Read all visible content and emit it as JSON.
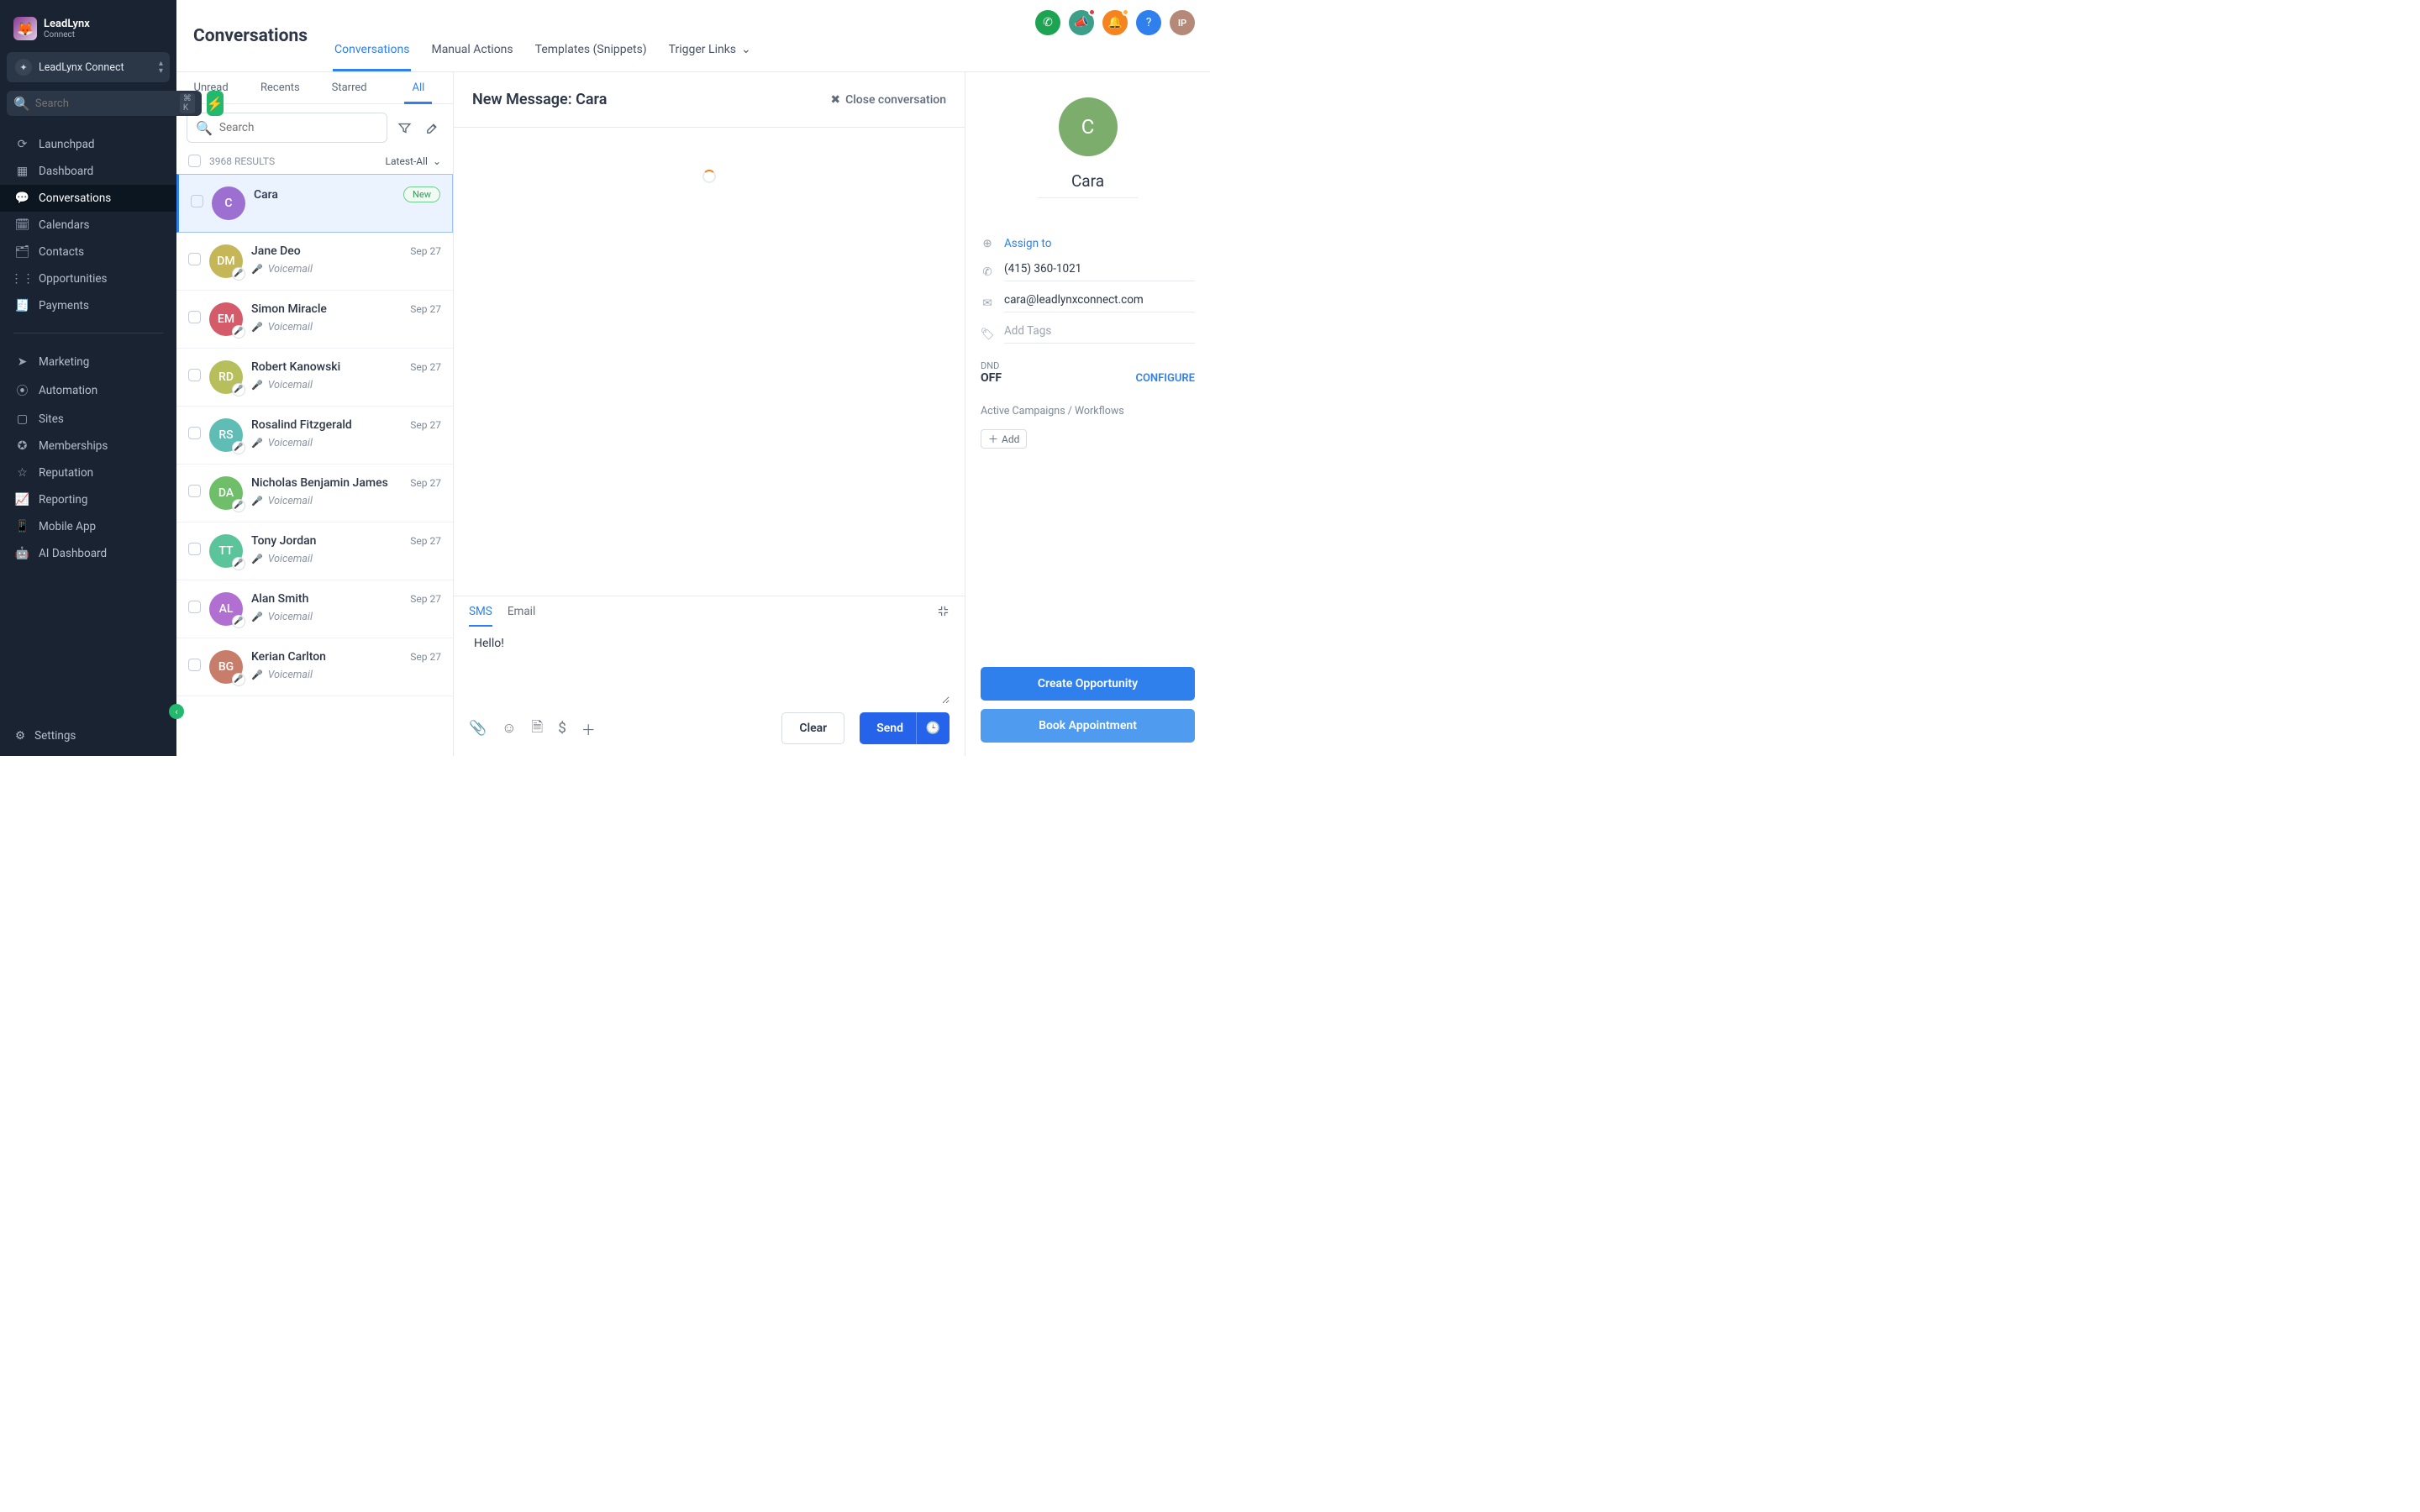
{
  "brand": {
    "name": "LeadLynx",
    "sub": "Connect"
  },
  "org": {
    "name": "LeadLynx Connect"
  },
  "globalSearch": {
    "placeholder": "Search",
    "kbd": "⌘ K"
  },
  "nav": {
    "items": [
      {
        "label": "Launchpad"
      },
      {
        "label": "Dashboard"
      },
      {
        "label": "Conversations"
      },
      {
        "label": "Calendars"
      },
      {
        "label": "Contacts"
      },
      {
        "label": "Opportunities"
      },
      {
        "label": "Payments"
      }
    ],
    "items2": [
      {
        "label": "Marketing"
      },
      {
        "label": "Automation"
      },
      {
        "label": "Sites"
      },
      {
        "label": "Memberships"
      },
      {
        "label": "Reputation"
      },
      {
        "label": "Reporting"
      },
      {
        "label": "Mobile App"
      },
      {
        "label": "AI Dashboard"
      }
    ],
    "settings": "Settings"
  },
  "header": {
    "title": "Conversations",
    "tabs": [
      "Conversations",
      "Manual Actions",
      "Templates (Snippets)",
      "Trigger Links"
    ],
    "avatarInitials": "IP"
  },
  "listTabs": [
    "Unread",
    "Recents",
    "Starred",
    "All"
  ],
  "listSearchPlaceholder": "Search",
  "resultsCount": "3968 RESULTS",
  "sortLabel": "Latest-All",
  "conversations": [
    {
      "initials": "C",
      "name": "Cara",
      "date": "",
      "badge": "New",
      "color": "#9d6fd1",
      "selected": true,
      "voicemail": false
    },
    {
      "initials": "DM",
      "name": "Jane Deo",
      "date": "Sep 27",
      "color": "#c5b657",
      "voicemail": true
    },
    {
      "initials": "EM",
      "name": "Simon Miracle",
      "date": "Sep 27",
      "color": "#d35b6a",
      "voicemail": true
    },
    {
      "initials": "RD",
      "name": "Robert Kanowski",
      "date": "Sep 27",
      "color": "#b6bf5c",
      "voicemail": true
    },
    {
      "initials": "RS",
      "name": "Rosalind Fitzgerald",
      "date": "Sep 27",
      "color": "#5fbdb6",
      "voicemail": true
    },
    {
      "initials": "DA",
      "name": "Nicholas Benjamin James",
      "date": "Sep 27",
      "color": "#6fbf6a",
      "voicemail": true
    },
    {
      "initials": "TT",
      "name": "Tony Jordan",
      "date": "Sep 27",
      "color": "#5cc49a",
      "voicemail": true
    },
    {
      "initials": "AL",
      "name": "Alan Smith",
      "date": "Sep 27",
      "color": "#b06fd1",
      "voicemail": true
    },
    {
      "initials": "BG",
      "name": "Kerian Carlton",
      "date": "Sep 27",
      "color": "#c77d6a",
      "voicemail": true
    }
  ],
  "voicemailLabel": "Voicemail",
  "message": {
    "title": "New Message: Cara",
    "close": "Close conversation",
    "compTabs": [
      "SMS",
      "Email"
    ],
    "body": "Hello!",
    "clear": "Clear",
    "send": "Send"
  },
  "contact": {
    "name": "Cara",
    "initial": "C",
    "assign": "Assign to",
    "phone": "(415) 360-1021",
    "email": "cara@leadlynxconnect.com",
    "addTags": "Add Tags",
    "dndLabel": "DND",
    "dndValue": "OFF",
    "configure": "CONFIGURE",
    "campaigns": "Active Campaigns / Workflows",
    "add": "Add",
    "createOpp": "Create Opportunity",
    "bookApp": "Book Appointment"
  }
}
